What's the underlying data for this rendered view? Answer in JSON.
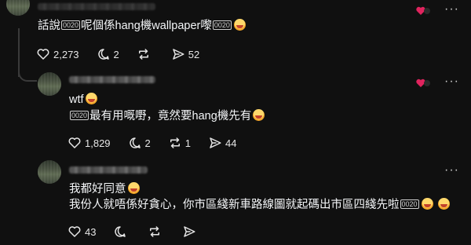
{
  "comments": [
    {
      "text": "話說",
      "text2": "呢個係hang機wallpaper嚟",
      "box": "0020",
      "stats": {
        "likes": "2,273",
        "replies": "2",
        "reposts": "",
        "shares": "52"
      }
    },
    {
      "line1": "wtf",
      "line2": "最有用嘅嘢，竟然要hang機先有",
      "box": "0020",
      "stats": {
        "likes": "1,829",
        "replies": "2",
        "reposts": "1",
        "shares": "44"
      }
    },
    {
      "line1": "我都好同意",
      "line2": "我份人就唔係好貪心，你市區綫新車路線圖就起碼出市區四綫先啦",
      "box": "0020",
      "stats": {
        "likes": "43",
        "replies": "",
        "reposts": "",
        "shares": ""
      }
    }
  ],
  "icons": {
    "more": "more-dots-icon",
    "like": "heart-icon",
    "reply": "reply-icon",
    "repost": "repost-icon",
    "share": "share-icon"
  },
  "colors": {
    "background": "#101010",
    "text": "#f3f5f7",
    "badge": "#e0245e"
  }
}
